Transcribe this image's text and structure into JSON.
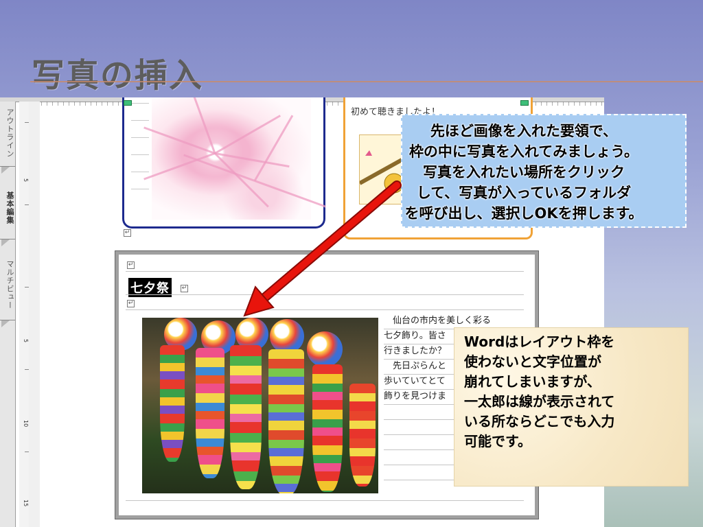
{
  "slide": {
    "title": "写真の挿入"
  },
  "editor": {
    "side_tabs": [
      "アウトライン",
      "基本編集",
      "マルチビュー"
    ],
    "ruler_marks": [
      "5",
      "5",
      "10",
      "15"
    ]
  },
  "upper_right_frame": {
    "text": "初めて聴きましたよ！"
  },
  "section": {
    "heading": "七夕祭",
    "column_lines": [
      "　仙台の市内を美しく彩る",
      "七夕飾り。皆さ",
      "行きましたか？",
      "　先日ぷらんと",
      "歩いていてとて",
      "飾りを見つけま"
    ]
  },
  "callouts": {
    "blue": "先ほど画像を入れた要領で、\n枠の中に写真を入れてみましょう。\n写真を入れたい場所をクリック\nして、写真が入っているフォルダ\nを呼び出し、選択しOKを押します。",
    "paper": "Wordはレイアウト枠を\n使わないと文字位置が\n崩れてしまいますが、\n一太郎は線が表示されて\nいる所ならどこでも入力\n可能です。"
  },
  "colors": {
    "frame_blue": "#1d2a8e",
    "frame_orange": "#f0a236",
    "arrow_red": "#e8140c",
    "callout_blue": "#a9cdf2"
  }
}
